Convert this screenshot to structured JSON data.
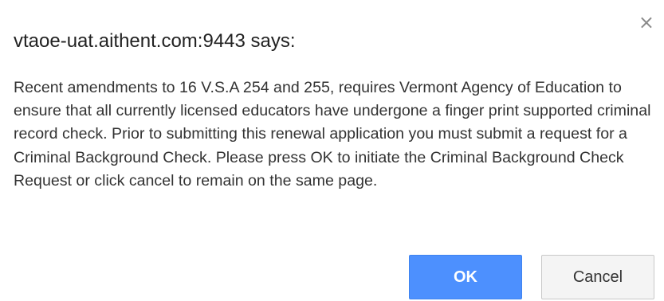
{
  "dialog": {
    "title": "vtaoe-uat.aithent.com:9443 says:",
    "message": "Recent amendments to 16 V.S.A 254 and 255, requires Vermont Agency of Education to ensure that all currently licensed educators have undergone a finger print supported criminal record check. Prior to submitting this renewal application you must submit a request for a Criminal Background Check. Please press OK to initiate the Criminal Background Check Request or click cancel to remain on the same page.",
    "close_icon": "close-icon",
    "ok_label": "OK",
    "cancel_label": "Cancel"
  },
  "colors": {
    "ok_button": "#4d90fe",
    "cancel_button": "#f4f4f4",
    "text": "#333333"
  }
}
